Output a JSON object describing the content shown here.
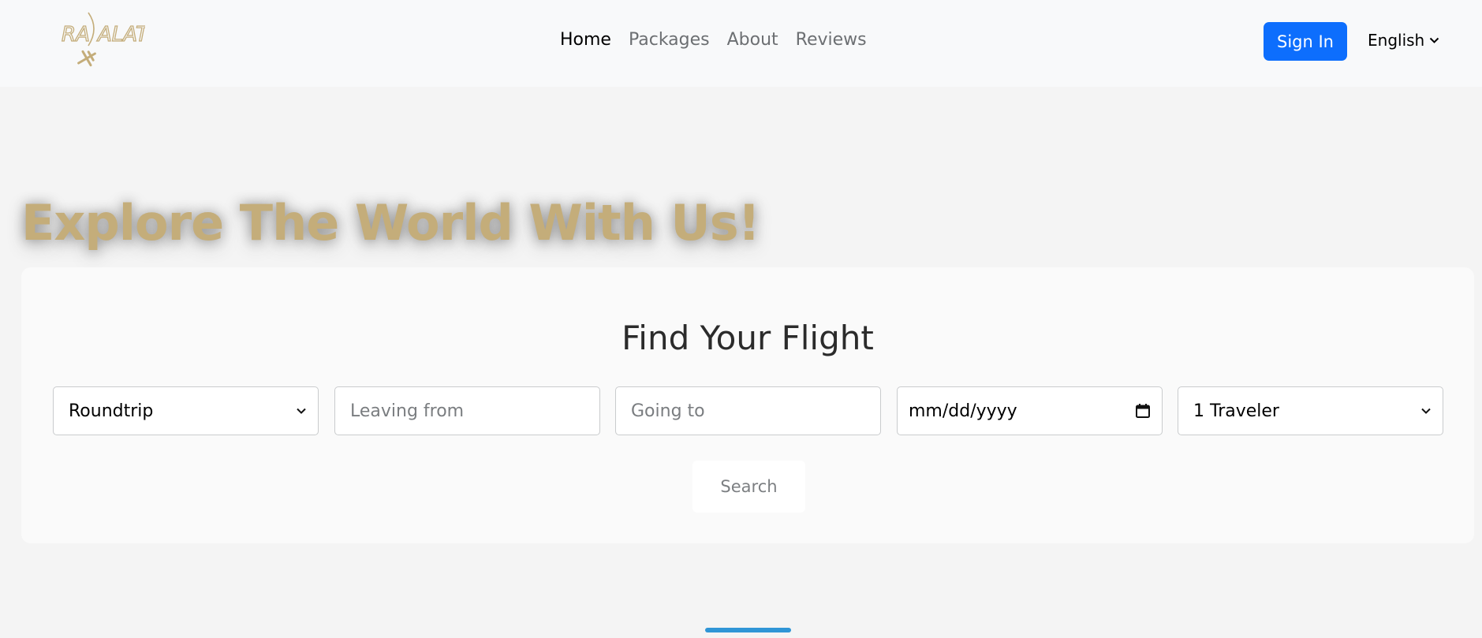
{
  "nav": {
    "logo_text": "RA ALAT",
    "links": [
      {
        "label": "Home",
        "active": true
      },
      {
        "label": "Packages",
        "active": false
      },
      {
        "label": "About",
        "active": false
      },
      {
        "label": "Reviews",
        "active": false
      }
    ],
    "signin_label": "Sign In",
    "language": "English"
  },
  "hero": {
    "title": "Explore The World With Us!"
  },
  "search": {
    "title": "Find Your Flight",
    "trip_type": "Roundtrip",
    "leaving_placeholder": "Leaving from",
    "going_placeholder": "Going to",
    "date_placeholder": "mm/dd/yyyy",
    "travelers": "1 Traveler",
    "button_label": "Search"
  },
  "colors": {
    "accent": "#0d6efd",
    "brand_gold": "#c4ad7a",
    "scroll_indicator": "#2f95d6"
  },
  "icons": [
    "plane-icon",
    "chevron-down-icon",
    "calendar-icon"
  ]
}
